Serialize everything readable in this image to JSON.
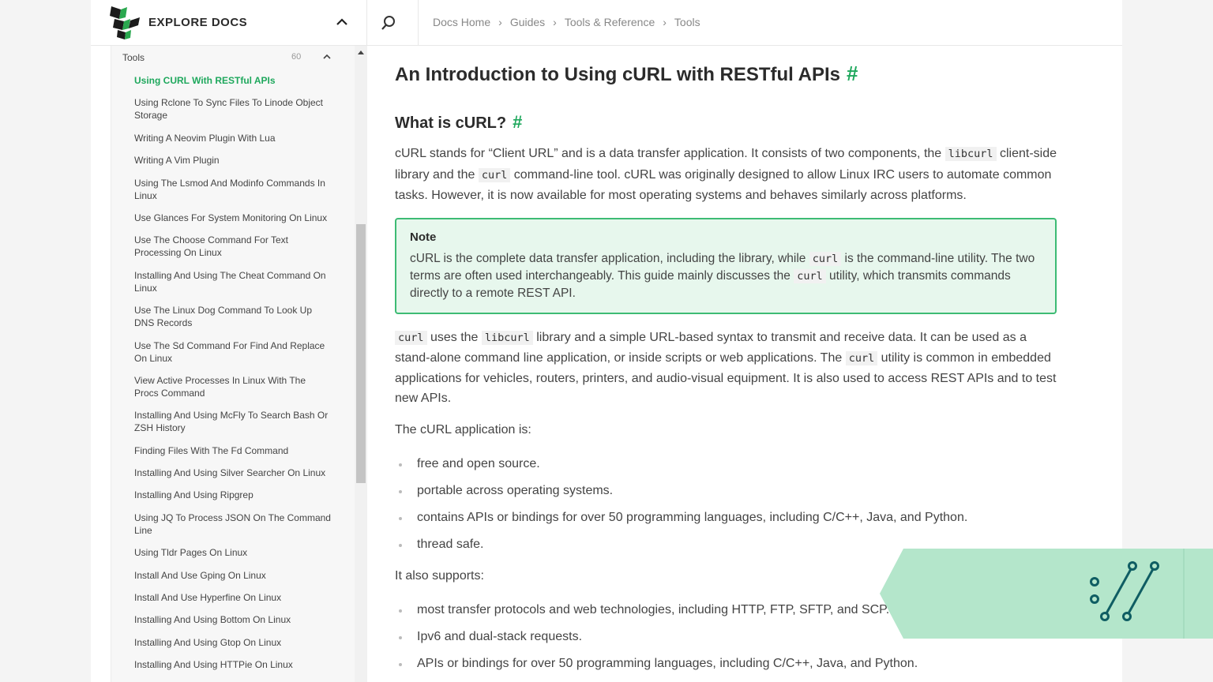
{
  "header": {
    "brand_title": "EXPLORE DOCS",
    "breadcrumb": [
      "Docs Home",
      "Guides",
      "Tools & Reference",
      "Tools"
    ]
  },
  "sidebar": {
    "section_title": "Tools",
    "section_count": "60",
    "items": [
      "Using CURL With RESTful APIs",
      "Using Rclone To Sync Files To Linode Object Storage",
      "Writing A Neovim Plugin With Lua",
      "Writing A Vim Plugin",
      "Using The Lsmod And Modinfo Commands In Linux",
      "Use Glances For System Monitoring On Linux",
      "Use The Choose Command For Text Processing On Linux",
      "Installing And Using The Cheat Command On Linux",
      "Use The Linux Dog Command To Look Up DNS Records",
      "Use The Sd Command For Find And Replace On Linux",
      "View Active Processes In Linux With The Procs Command",
      "Installing And Using McFly To Search Bash Or ZSH History",
      "Finding Files With The Fd Command",
      "Installing And Using Silver Searcher On Linux",
      "Installing And Using Ripgrep",
      "Using JQ To Process JSON On The Command Line",
      "Using Tldr Pages On Linux",
      "Install And Use Gping On Linux",
      "Install And Use Hyperfine On Linux",
      "Installing And Using Bottom On Linux",
      "Installing And Using Gtop On Linux",
      "Installing And Using HTTPie On Linux"
    ]
  },
  "article": {
    "title": "An Introduction to Using cURL with RESTful APIs",
    "anchor": "#",
    "section_title": "What is cURL?",
    "p1": {
      "a": "cURL stands for “Client URL” and is a data transfer application. It consists of two components, the ",
      "code1": "libcurl",
      "b": " client-side library and the ",
      "code2": "curl",
      "c": " command-line tool. cURL was originally designed to allow Linux IRC users to automate common tasks. However, it is now available for most operating systems and behaves similarly across platforms."
    },
    "note": {
      "title": "Note",
      "a": "cURL is the complete data transfer application, including the library, while ",
      "code1": "curl",
      "b": " is the command-line utility. The two terms are often used interchangeably. This guide mainly discusses the ",
      "code2": "curl",
      "c": " utility, which transmits commands directly to a remote REST API."
    },
    "p2": {
      "code1": "curl",
      "a": " uses the ",
      "code2": "libcurl",
      "b": " library and a simple URL-based syntax to transmit and receive data. It can be used as a stand-alone command line application, or inside scripts or web applications. The ",
      "code3": "curl",
      "c": " utility is common in embedded applications for vehicles, routers, printers, and audio-visual equipment. It is also used to access REST APIs and to test new APIs."
    },
    "p3": "The cURL application is:",
    "list1": [
      "free and open source.",
      "portable across operating systems.",
      "contains APIs or bindings for over 50 programming languages, including C/C++, Java, and Python.",
      "thread safe."
    ],
    "p4": "It also supports:",
    "list2": [
      "most transfer protocols and web technologies, including HTTP, FTP, SFTP, and SCP.",
      "Ipv6 and dual-stack requests.",
      "APIs or bindings for over 50 programming languages, including C/C++, Java, and Python."
    ]
  },
  "colors": {
    "accent": "#1fa85d",
    "note_bg": "#e7f7ed",
    "note_border": "#3dbb74",
    "banner": "#b4e6cb",
    "banner_icon": "#0f5d63"
  }
}
